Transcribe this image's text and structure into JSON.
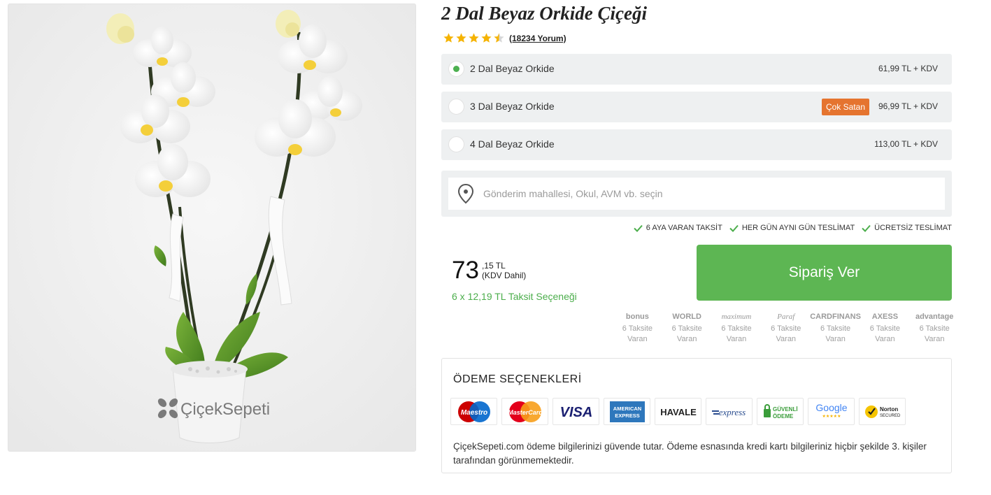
{
  "product": {
    "title": "2 Dal Beyaz Orkide Çiçeği",
    "rating": 4.5,
    "reviews_label": "(18234 Yorum)",
    "watermark": "ÇiçekSepeti"
  },
  "variants": [
    {
      "label": "2 Dal Beyaz Orkide",
      "price": "61,99 TL + KDV",
      "selected": true,
      "badge": ""
    },
    {
      "label": "3 Dal Beyaz Orkide",
      "price": "96,99 TL + KDV",
      "selected": false,
      "badge": "Çok Satan"
    },
    {
      "label": "4 Dal Beyaz Orkide",
      "price": "113,00 TL + KDV",
      "selected": false,
      "badge": ""
    }
  ],
  "address": {
    "placeholder": "Gönderim mahallesi, Okul, AVM vb. seçin",
    "icon": "location-pin-icon"
  },
  "features": [
    "6 AYA VARAN TAKSİT",
    "HER GÜN AYNI GÜN TESLİMAT",
    "ÜCRETSİZ TESLİMAT"
  ],
  "price": {
    "integer": "73",
    "fraction": ",15 TL",
    "tax_note": "(KDV Dahil)",
    "installment": "6 x 12,19 TL Taksit Seçeneği"
  },
  "order_button": {
    "label": "Sipariş Ver"
  },
  "banks": [
    {
      "logo": "bonus",
      "line1": "6 Taksite",
      "line2": "Varan"
    },
    {
      "logo": "WORLD",
      "line1": "6 Taksite",
      "line2": "Varan"
    },
    {
      "logo": "maximum",
      "line1": "6 Taksite",
      "line2": "Varan"
    },
    {
      "logo": "Paraf",
      "line1": "6 Taksite",
      "line2": "Varan"
    },
    {
      "logo": "CARDFINANS",
      "line1": "6 Taksite",
      "line2": "Varan"
    },
    {
      "logo": "AXESS",
      "line1": "6 Taksite",
      "line2": "Varan"
    },
    {
      "logo": "advantage",
      "line1": "6 Taksite",
      "line2": "Varan"
    }
  ],
  "payment": {
    "title": "ÖDEME SEÇENEKLERİ",
    "logos": {
      "maestro": "Maestro",
      "mastercard": "MasterCard",
      "visa": "VISA",
      "amex_line1": "AMERICAN",
      "amex_line2": "EXPRESS",
      "havale": "HAVALE",
      "bkm": "express",
      "secure_line1": "GÜVENLİ",
      "secure_line2": "ÖDEME",
      "google": "Google",
      "norton_line1": "Norton",
      "norton_line2": "SECURED"
    },
    "note": "ÇiçekSepeti.com ödeme bilgilerinizi güvende tutar. Ödeme esnasında kredi kartı bilgileriniz hiçbir şekilde 3. kişiler tarafından görünmemektedir."
  },
  "colors": {
    "accent_green": "#5db653",
    "star_gold": "#f5b301",
    "badge_orange": "#e5742f"
  }
}
